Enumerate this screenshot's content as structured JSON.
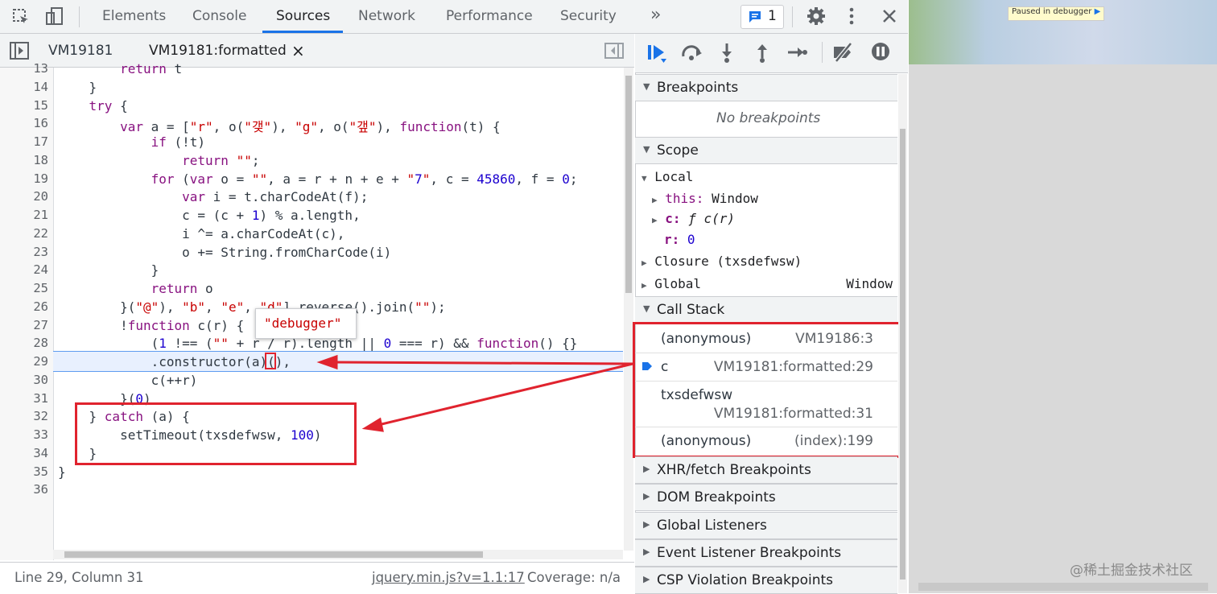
{
  "toolbar": {
    "tabs": [
      "Elements",
      "Console",
      "Sources",
      "Network",
      "Performance",
      "Security"
    ],
    "more": "»",
    "issues_count": "1"
  },
  "file_tabs": {
    "tab1": "VM19181",
    "tab2": "VM19181:formatted",
    "close": "×"
  },
  "code_lines": [
    {
      "n": "13",
      "t": "        return t"
    },
    {
      "n": "14",
      "t": "    }"
    },
    {
      "n": "15",
      "t": "    try {"
    },
    {
      "n": "16",
      "t": "        var a = [\"r\", o(\"갲\"), \"g\", o(\"갶\"), function(t) {"
    },
    {
      "n": "17",
      "t": "            if (!t)"
    },
    {
      "n": "18",
      "t": "                return \"\";"
    },
    {
      "n": "19",
      "t": "            for (var o = \"\", a = r + n + e + \"7\", c = 45860, f = 0;"
    },
    {
      "n": "20",
      "t": "                var i = t.charCodeAt(f);"
    },
    {
      "n": "21",
      "t": "                c = (c + 1) % a.length,"
    },
    {
      "n": "22",
      "t": "                i ^= a.charCodeAt(c),"
    },
    {
      "n": "23",
      "t": "                o += String.fromCharCode(i)"
    },
    {
      "n": "24",
      "t": "            }"
    },
    {
      "n": "25",
      "t": "            return o"
    },
    {
      "n": "26",
      "t": "        }(\"@\"), \"b\", \"e\", \"d\"].reverse().join(\"\");"
    },
    {
      "n": "27",
      "t": "        !function c(r) {"
    },
    {
      "n": "28",
      "t": "            (1 !== (\"\" + r / r).length || 0 === r) && function() {}"
    },
    {
      "n": "29",
      "t": "            .constructor(a)(),"
    },
    {
      "n": "30",
      "t": "            c(++r)"
    },
    {
      "n": "31",
      "t": "        }(0)"
    },
    {
      "n": "32",
      "t": "    } catch (a) {"
    },
    {
      "n": "33",
      "t": "        setTimeout(txsdefwsw, 100)"
    },
    {
      "n": "34",
      "t": "    }"
    },
    {
      "n": "35",
      "t": "}"
    },
    {
      "n": "36",
      "t": ""
    }
  ],
  "tooltip": "\"debugger\"",
  "status": {
    "position": "Line 29, Column 31",
    "source_link": "jquery.min.js?v=1.1:17",
    "coverage": "Coverage: n/a"
  },
  "debugger": {
    "breakpoints_header": "Breakpoints",
    "no_breakpoints": "No breakpoints",
    "scope_header": "Scope",
    "local": "Local",
    "this_key": "this:",
    "this_val": "Window",
    "c_key": "c:",
    "c_val": "ƒ c(r)",
    "r_key": "r:",
    "r_val": "0",
    "closure": "Closure (txsdefwsw)",
    "global": "Global",
    "global_val": "Window",
    "callstack_header": "Call Stack",
    "callstack": [
      {
        "fn": "(anonymous)",
        "loc": "VM19186:3"
      },
      {
        "fn": "c",
        "loc": "VM19181:formatted:29"
      },
      {
        "fn": "txsdefwsw",
        "loc": "VM19181:formatted:31"
      },
      {
        "fn": "(anonymous)",
        "loc": "(index):199"
      }
    ],
    "xhr": "XHR/fetch Breakpoints",
    "dom": "DOM Breakpoints",
    "global_listeners": "Global Listeners",
    "event_listener": "Event Listener Breakpoints",
    "csp": "CSP Violation Breakpoints"
  },
  "page": {
    "paused_label": "Paused in debugger",
    "watermark": "@稀土掘金技术社区"
  },
  "colors": {
    "accent": "#1a73e8",
    "highlight": "#e0232e"
  }
}
